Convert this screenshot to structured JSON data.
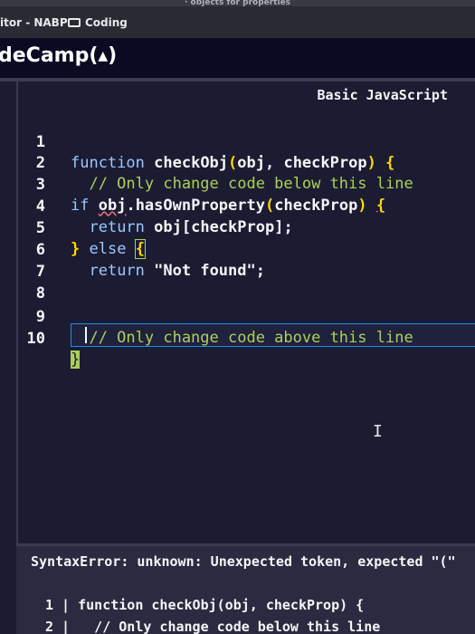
{
  "browser": {
    "top_strip": "· objects for properties",
    "bookmark_1": "itor - NABP",
    "bookmark_2": "Coding"
  },
  "header": {
    "title": "deCamp(",
    "logo_glyph": "▲",
    "title_end": ")"
  },
  "editor": {
    "tab_label": "Basic JavaScript",
    "lines": [
      {
        "num": "1",
        "text": "function checkObj(obj, checkProp) {"
      },
      {
        "num": "2",
        "text": "  // Only change code below this line"
      },
      {
        "num": "3",
        "text": "if obj.hasOwnProperty(checkProp) {"
      },
      {
        "num": "4",
        "text": "  return obj[checkProp];"
      },
      {
        "num": "5",
        "text": "} else {"
      },
      {
        "num": "6",
        "text": "  return \"Not found\";"
      },
      {
        "num": "7",
        "text": ""
      },
      {
        "num": "8",
        "text": ""
      },
      {
        "num": "9",
        "text": "  // Only change code above this line"
      },
      {
        "num": "10",
        "text": "}"
      }
    ],
    "cursor_line": "7"
  },
  "console": {
    "error": "SyntaxError: unknown: Unexpected token, expected \"(\"",
    "excerpt": [
      "1 | function checkObj(obj, checkProp) {",
      "2 |   // Only change code below this line"
    ]
  },
  "colors": {
    "background": "#1b1b32",
    "header_bg": "#0a0a23",
    "keyword": "#99c9ff",
    "comment": "#acd157",
    "bracket": "#ffd700",
    "active_line_border": "#198eee"
  }
}
